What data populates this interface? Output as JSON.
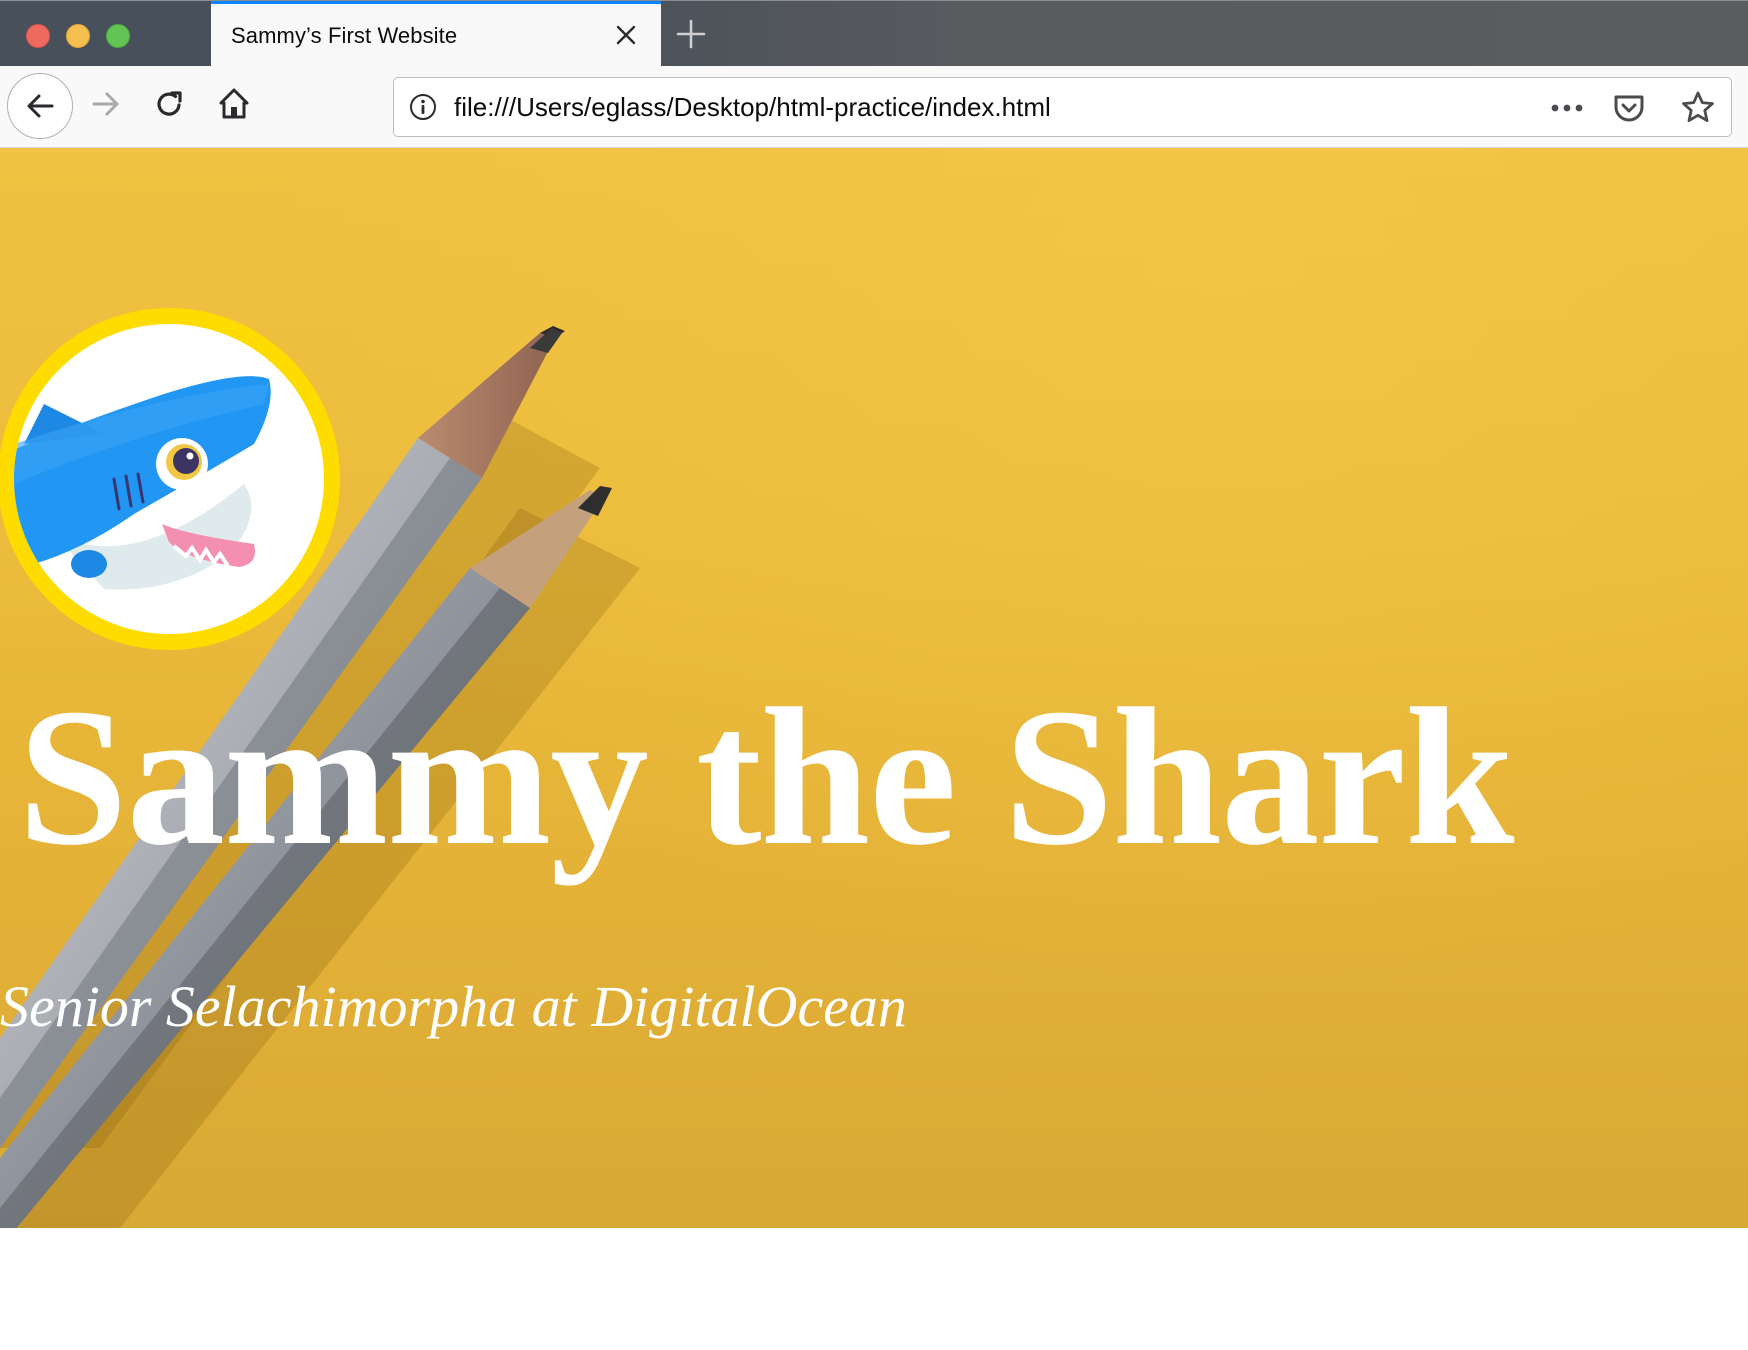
{
  "browser": {
    "tab": {
      "title": "Sammy’s First Website",
      "close_icon": "close-icon"
    },
    "new_tab_icon": "plus-icon",
    "traffic_lights": [
      {
        "name": "close-window",
        "color": "#ee6a5f"
      },
      {
        "name": "minimize-window",
        "color": "#f6be4f"
      },
      {
        "name": "zoom-window",
        "color": "#61c454"
      }
    ],
    "nav": {
      "back_icon": "arrow-left-icon",
      "forward_icon": "arrow-right-icon",
      "reload_icon": "reload-icon",
      "home_icon": "home-icon"
    },
    "urlbar": {
      "url": "file:///Users/eglass/Desktop/html-practice/index.html",
      "info_icon": "info-icon",
      "page_actions_icon": "ellipsis-icon",
      "pocket_icon": "pocket-icon",
      "bookmark_icon": "star-icon"
    },
    "accent_color": "#0a84ff"
  },
  "page": {
    "hero": {
      "title": "Sammy the Shark",
      "subtitle": "Senior Selachimorpha at DigitalOcean",
      "background_color": "#ebbb3d",
      "avatar_border_color": "#fedc00",
      "avatar_subject": "shark-illustration",
      "background_subject": "two-pencils-on-yellow-paper"
    }
  }
}
